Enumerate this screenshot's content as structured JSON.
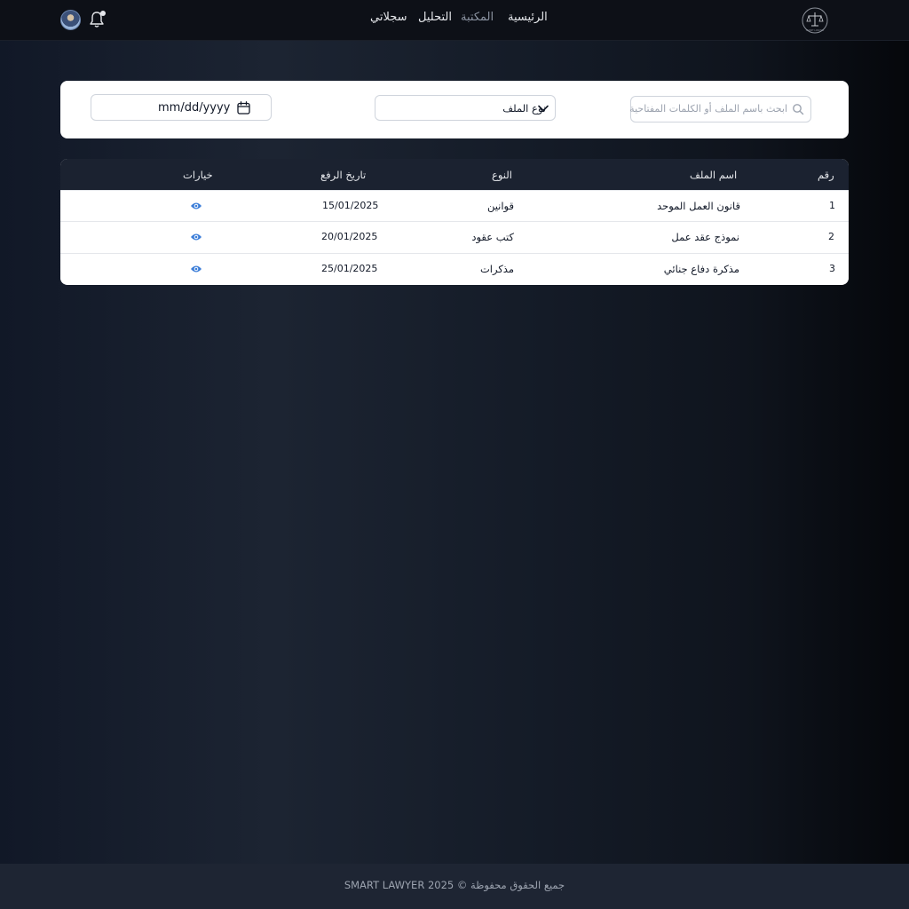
{
  "header": {
    "logo_text": "SMART LAWYER",
    "nav": [
      {
        "label": "الرئيسية",
        "active": false
      },
      {
        "label": "المكتبة",
        "active": true
      },
      {
        "label": "التحليل",
        "active": false
      },
      {
        "label": "سجلاتي",
        "active": false
      }
    ],
    "icons": {
      "bell": "bell-icon",
      "avatar": "avatar"
    }
  },
  "filters": {
    "search_placeholder": "ابحث باسم الملف أو الكلمات المفتاحية",
    "type_select_value": "نوع الملف",
    "date_value": "mm/dd/yyyy"
  },
  "table": {
    "headers": {
      "num": "رقم",
      "name": "اسم الملف",
      "type": "النوع",
      "date": "تاريخ الرفع",
      "options": "خيارات"
    },
    "rows": [
      {
        "num": "1",
        "name": "قانون العمل الموحد",
        "type": "قوانين",
        "date": "15/01/2025"
      },
      {
        "num": "2",
        "name": "نموذج عقد عمل",
        "type": "كتب عقود",
        "date": "20/01/2025"
      },
      {
        "num": "3",
        "name": "مذكرة دفاع جنائي",
        "type": "مذكرات",
        "date": "25/01/2025"
      }
    ]
  },
  "footer": {
    "text": "جميع الحقوق محفوظة © SMART LAWYER 2025"
  },
  "colors": {
    "accent_eye": "#3b7dd8",
    "table_header_bg": "#1b2230",
    "footer_bg": "#1e2533"
  }
}
